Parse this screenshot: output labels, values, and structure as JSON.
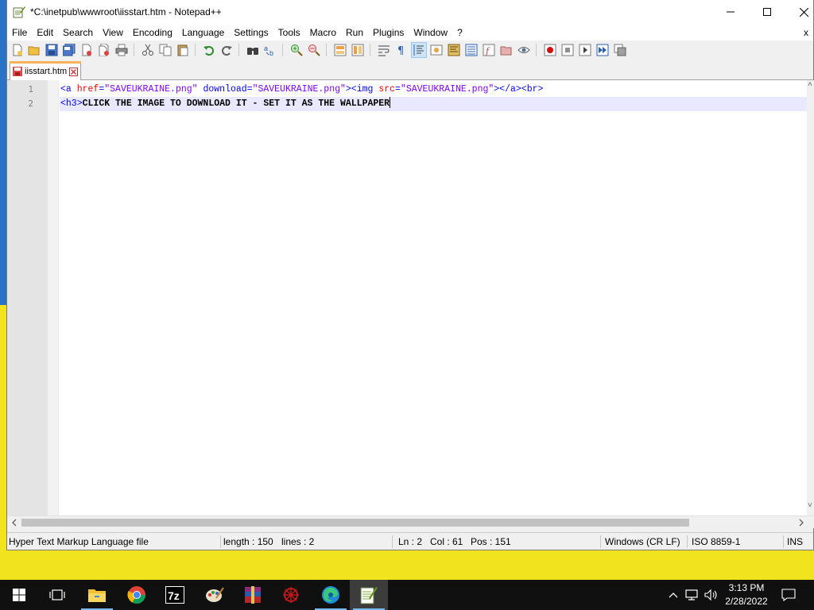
{
  "window": {
    "title": "*C:\\inetpub\\wwwroot\\iisstart.htm - Notepad++",
    "menu_close_label": "x"
  },
  "menu": [
    "File",
    "Edit",
    "Search",
    "View",
    "Encoding",
    "Language",
    "Settings",
    "Tools",
    "Macro",
    "Run",
    "Plugins",
    "Window",
    "?"
  ],
  "tab": {
    "label": "iisstart.htm"
  },
  "editor": {
    "line_numbers": [
      "1",
      "2"
    ],
    "lines": [
      [
        {
          "cls": "t-tag",
          "text": "<a "
        },
        {
          "cls": "t-attr",
          "text": "href"
        },
        {
          "cls": "t-tag",
          "text": "="
        },
        {
          "cls": "t-str",
          "text": "\"SAVEUKRAINE.png\""
        },
        {
          "cls": "t-tag",
          "text": " download="
        },
        {
          "cls": "t-str",
          "text": "\"SAVEUKRAINE.png\""
        },
        {
          "cls": "t-tag",
          "text": "><img "
        },
        {
          "cls": "t-attr",
          "text": "src"
        },
        {
          "cls": "t-tag",
          "text": "="
        },
        {
          "cls": "t-str",
          "text": "\"SAVEUKRAINE.png\""
        },
        {
          "cls": "t-tag",
          "text": "></a><br>"
        }
      ],
      [
        {
          "cls": "t-tag",
          "text": "<h3>"
        },
        {
          "cls": "t-txt",
          "text": "CLICK THE IMAGE TO DOWNLOAD IT - SET IT AS THE WALLPAPER"
        }
      ]
    ],
    "current_line": 2
  },
  "status": {
    "file_type": "Hyper Text Markup Language file",
    "length": "length : 150",
    "lines": "lines : 2",
    "ln": "Ln : 2",
    "col": "Col : 61",
    "pos": "Pos : 151",
    "eol": "Windows (CR LF)",
    "encoding": "ISO 8859-1",
    "mode": "INS"
  },
  "taskbar": {
    "time": "3:13 PM",
    "date": "2/28/2022",
    "apps": [
      "start-icon",
      "task-view-icon",
      "file-explorer-icon",
      "chrome-icon",
      "7zip-icon",
      "paint-icon",
      "winrar-icon",
      "red-app-icon",
      "edge-icon",
      "notepadpp-icon"
    ]
  },
  "colors": {
    "wallpaper_blue": "#2a72c4",
    "wallpaper_yellow": "#f1e41f",
    "tag": "#0000ff",
    "attribute": "#ff0000",
    "string": "#8000ff",
    "current_line": "#e8e8ff",
    "tab_accent": "#fab25b"
  }
}
